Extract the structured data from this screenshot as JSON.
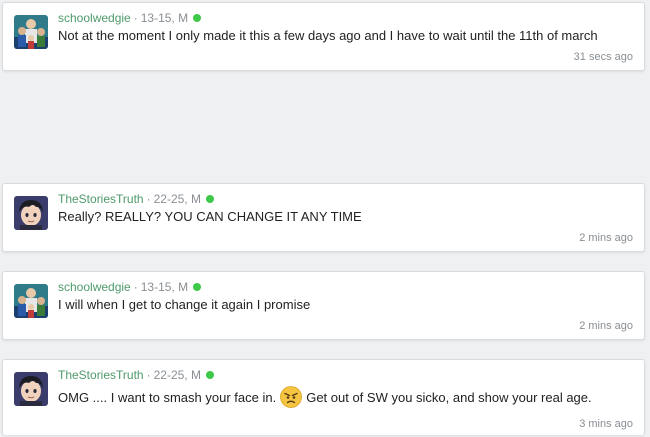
{
  "messages": [
    {
      "username": "schoolwedgie",
      "age_gender": "13-15, M",
      "text": "Not at the moment I only made it this a few days ago and I have to wait until the 11th of march",
      "time": "31 secs ago",
      "avatar": "family-group-avatar-icon"
    },
    {
      "username": "TheStoriesTruth",
      "age_gender": "22-25, M",
      "text": "Really? REALLY? YOU CAN CHANGE IT ANY TIME",
      "time": "2 mins ago",
      "avatar": "anime-boy-avatar-icon"
    },
    {
      "username": "schoolwedgie",
      "age_gender": "13-15, M",
      "text": "I will when I get to change it again I promise",
      "time": "2 mins ago",
      "avatar": "family-group-avatar-icon"
    },
    {
      "username": "TheStoriesTruth",
      "age_gender": "22-25, M",
      "text_before": "OMG .... I want to smash your face in.",
      "emoji": "angry-face-emoji",
      "text_after": "Get out of SW you sicko, and show your real age.",
      "time": "3 mins ago",
      "avatar": "anime-boy-avatar-icon"
    }
  ],
  "separator": "·",
  "colors": {
    "username": "#4f9a6b",
    "online_dot": "#3ec948",
    "background": "#eef0f2"
  }
}
